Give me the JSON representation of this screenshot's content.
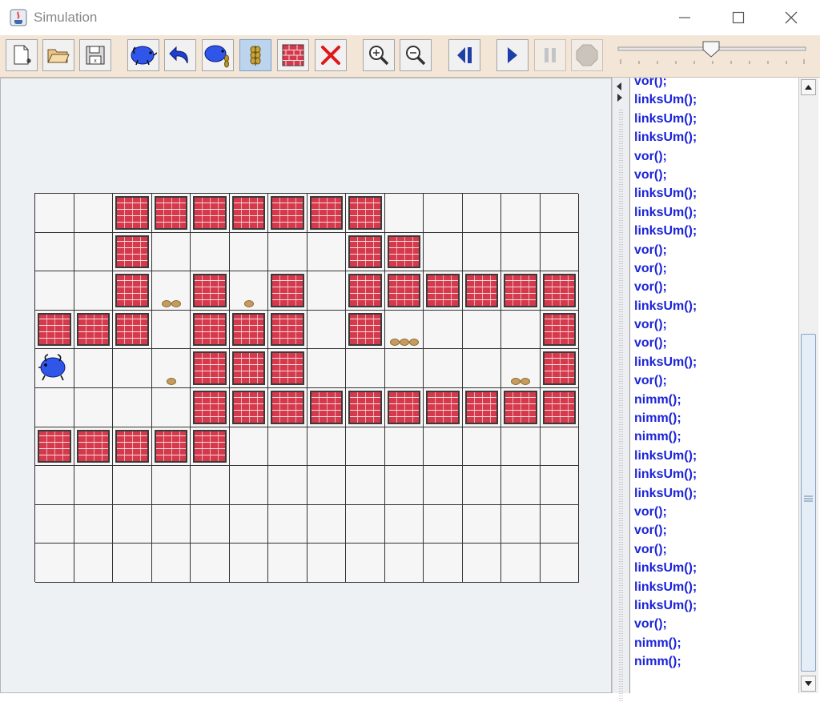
{
  "window": {
    "title": "Simulation"
  },
  "toolbar": {
    "buttons": [
      {
        "name": "new-territory-button",
        "icon": "new-file-icon"
      },
      {
        "name": "open-territory-button",
        "icon": "folder-open-icon"
      },
      {
        "name": "save-territory-button",
        "icon": "floppy-disk-icon"
      },
      {
        "name": "place-hamster-button",
        "icon": "hamster-icon"
      },
      {
        "name": "turn-hamster-button",
        "icon": "undo-arrow-icon"
      },
      {
        "name": "hamster-grain-button",
        "icon": "hamster-grain-icon"
      },
      {
        "name": "place-grain-button",
        "icon": "wheat-icon"
      },
      {
        "name": "place-wall-button",
        "icon": "brick-wall-icon"
      },
      {
        "name": "delete-tile-button",
        "icon": "red-x-icon"
      },
      {
        "name": "zoom-in-button",
        "icon": "zoom-in-icon"
      },
      {
        "name": "zoom-out-button",
        "icon": "zoom-out-icon"
      },
      {
        "name": "step-back-button",
        "icon": "step-back-icon"
      },
      {
        "name": "play-button",
        "icon": "play-icon"
      },
      {
        "name": "pause-button",
        "icon": "pause-icon"
      },
      {
        "name": "stop-button",
        "icon": "stop-icon"
      }
    ],
    "speed_value": 0.5
  },
  "territory": {
    "cols": 14,
    "rows": 10,
    "walls": [
      [
        0,
        2
      ],
      [
        0,
        3
      ],
      [
        0,
        4
      ],
      [
        0,
        5
      ],
      [
        0,
        6
      ],
      [
        0,
        7
      ],
      [
        0,
        8
      ],
      [
        1,
        2
      ],
      [
        1,
        8
      ],
      [
        1,
        9
      ],
      [
        2,
        2
      ],
      [
        2,
        4
      ],
      [
        2,
        6
      ],
      [
        2,
        8
      ],
      [
        2,
        9
      ],
      [
        2,
        10
      ],
      [
        2,
        11
      ],
      [
        2,
        12
      ],
      [
        2,
        13
      ],
      [
        3,
        0
      ],
      [
        3,
        1
      ],
      [
        3,
        2
      ],
      [
        3,
        4
      ],
      [
        3,
        5
      ],
      [
        3,
        6
      ],
      [
        3,
        8
      ],
      [
        3,
        13
      ],
      [
        4,
        4
      ],
      [
        4,
        5
      ],
      [
        4,
        6
      ],
      [
        4,
        13
      ],
      [
        5,
        4
      ],
      [
        5,
        5
      ],
      [
        5,
        6
      ],
      [
        5,
        7
      ],
      [
        5,
        8
      ],
      [
        5,
        9
      ],
      [
        5,
        10
      ],
      [
        5,
        11
      ],
      [
        5,
        12
      ],
      [
        5,
        13
      ],
      [
        6,
        0
      ],
      [
        6,
        1
      ],
      [
        6,
        2
      ],
      [
        6,
        3
      ],
      [
        6,
        4
      ]
    ],
    "grains": [
      {
        "row": 2,
        "col": 3,
        "count": 2
      },
      {
        "row": 2,
        "col": 5,
        "count": 1
      },
      {
        "row": 3,
        "col": 9,
        "count": 3
      },
      {
        "row": 4,
        "col": 3,
        "count": 1
      },
      {
        "row": 4,
        "col": 12,
        "count": 2
      }
    ],
    "hamster": {
      "row": 4,
      "col": 0,
      "facing": "west"
    }
  },
  "program": {
    "lines": [
      "vor();",
      "linksUm();",
      "linksUm();",
      "linksUm();",
      "vor();",
      "vor();",
      "linksUm();",
      "linksUm();",
      "linksUm();",
      "vor();",
      "vor();",
      "vor();",
      "linksUm();",
      "vor();",
      "vor();",
      "linksUm();",
      "vor();",
      "nimm();",
      "nimm();",
      "nimm();",
      "linksUm();",
      "linksUm();",
      "linksUm();",
      "vor();",
      "vor();",
      "vor();",
      "linksUm();",
      "linksUm();",
      "linksUm();",
      "vor();",
      "nimm();",
      "nimm();"
    ]
  }
}
